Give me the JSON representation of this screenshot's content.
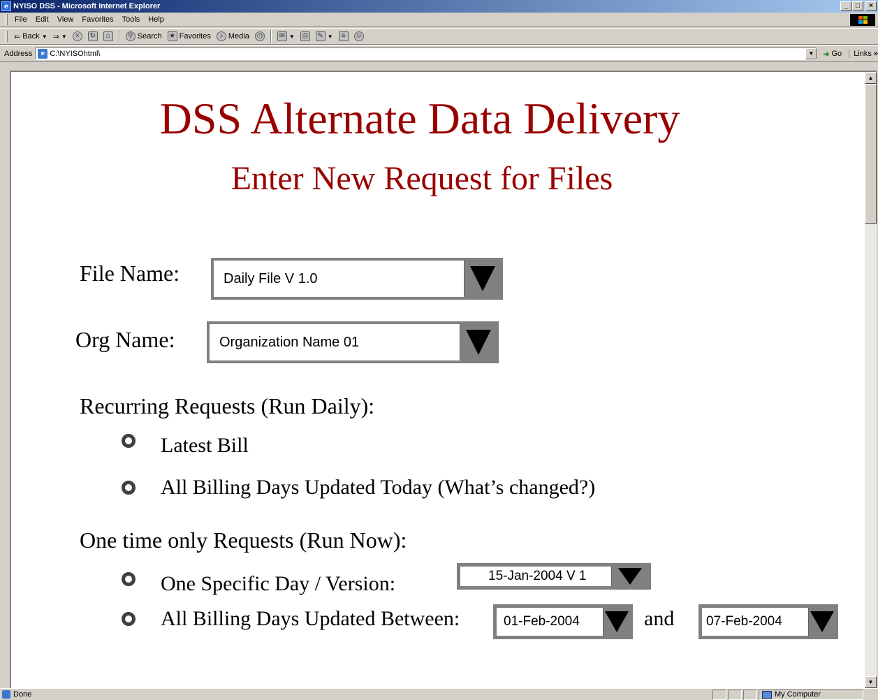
{
  "window": {
    "title": "NYISO DSS - Microsoft Internet Explorer",
    "buttons": [
      "_",
      "□",
      "×"
    ]
  },
  "menubar": {
    "items": [
      "File",
      "Edit",
      "View",
      "Favorites",
      "Tools",
      "Help"
    ]
  },
  "toolbar": {
    "back_label": "Back",
    "search_label": "Search",
    "favorites_label": "Favorites",
    "media_label": "Media"
  },
  "address": {
    "label": "Address",
    "value": "C:\\NYISOhtml\\",
    "go_label": "Go",
    "links_label": "Links"
  },
  "page": {
    "title": "DSS Alternate Data Delivery",
    "subtitle": "Enter New Request for Files",
    "file_name_label": "File Name:",
    "file_name_value": "Daily File V 1.0",
    "org_name_label": "Org Name:",
    "org_name_value": "Organization Name 01",
    "recurring_heading": "Recurring Requests (Run Daily):",
    "recurring_options": [
      "Latest Bill",
      "All Billing Days Updated Today (What’s changed?)"
    ],
    "onetime_heading": "One time only Requests (Run Now):",
    "specific_day_label": "One Specific Day / Version:",
    "specific_day_value": "15-Jan-2004 V 1",
    "between_label": "All Billing Days Updated Between:",
    "between_start": "01-Feb-2004",
    "between_and": "and",
    "between_end": "07-Feb-2004"
  },
  "statusbar": {
    "status": "Done",
    "zone": "My Computer"
  }
}
